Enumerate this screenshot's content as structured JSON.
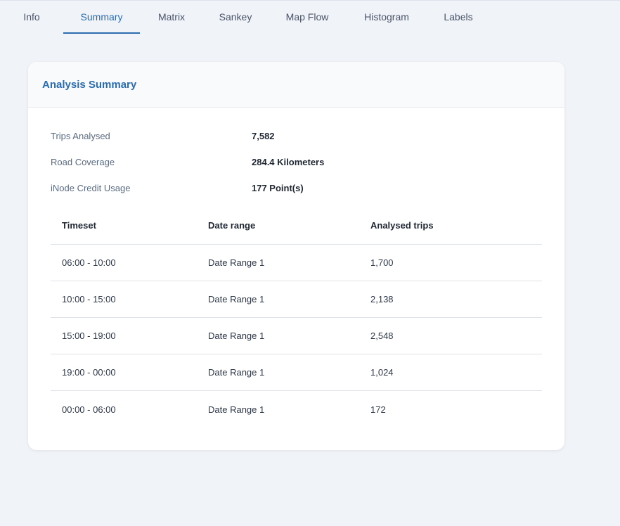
{
  "tabs": [
    {
      "label": "Info",
      "active": false
    },
    {
      "label": "Summary",
      "active": true
    },
    {
      "label": "Matrix",
      "active": false
    },
    {
      "label": "Sankey",
      "active": false
    },
    {
      "label": "Map Flow",
      "active": false
    },
    {
      "label": "Histogram",
      "active": false
    },
    {
      "label": "Labels",
      "active": false
    }
  ],
  "card": {
    "title": "Analysis Summary",
    "stats": [
      {
        "label": "Trips Analysed",
        "value": "7,582"
      },
      {
        "label": "Road Coverage",
        "value": "284.4 Kilometers"
      },
      {
        "label": "iNode Credit Usage",
        "value": "177 Point(s)"
      }
    ],
    "table": {
      "headers": [
        "Timeset",
        "Date range",
        "Analysed trips"
      ],
      "rows": [
        [
          "06:00 - 10:00",
          "Date Range 1",
          "1,700"
        ],
        [
          "10:00 - 15:00",
          "Date Range 1",
          "2,138"
        ],
        [
          "15:00 - 19:00",
          "Date Range 1",
          "2,548"
        ],
        [
          "19:00 - 00:00",
          "Date Range 1",
          "1,024"
        ],
        [
          "00:00 - 06:00",
          "Date Range 1",
          "172"
        ]
      ]
    }
  },
  "colors": {
    "accent": "#2b6cb0",
    "background": "#f0f3f8",
    "card": "#ffffff"
  }
}
